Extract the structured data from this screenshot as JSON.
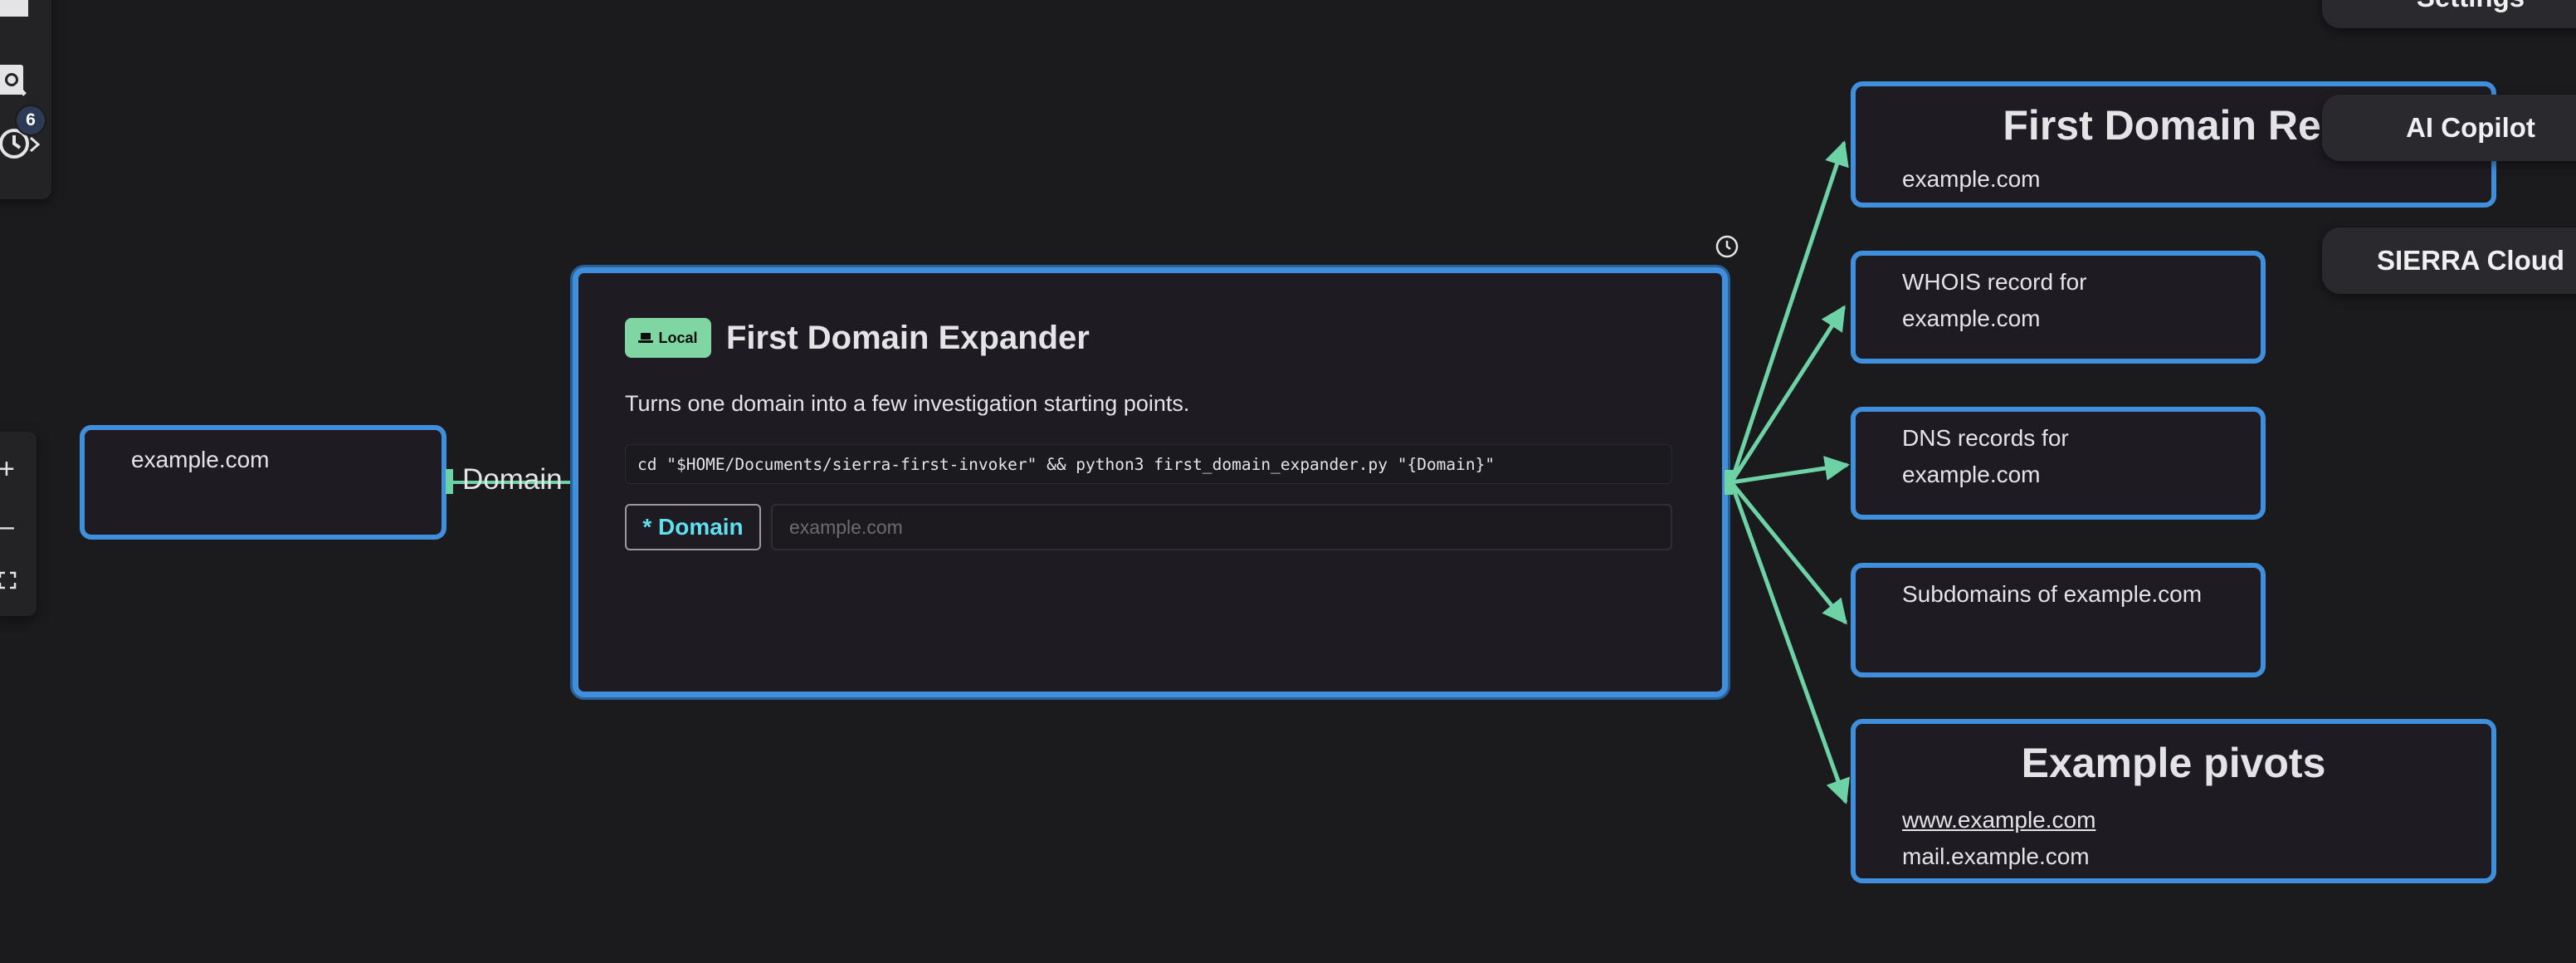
{
  "toolbar": {
    "history_count": "6",
    "zoom_in": "+",
    "zoom_out": "–",
    "icons": [
      "folder-icon",
      "search-icon",
      "history-icon",
      "chevron-right-icon",
      "fit-view-icon"
    ]
  },
  "input_node": {
    "value": "example.com"
  },
  "edge": {
    "label": "Domain"
  },
  "transform_node": {
    "badge": "Local",
    "title": "First Domain Expander",
    "description": "Turns one domain into a few investigation starting points.",
    "command": "cd \"$HOME/Documents/sierra-first-invoker\" && python3 first_domain_expander.py \"{Domain}\"",
    "param_label": "* Domain",
    "param_placeholder": "example.com"
  },
  "output_nodes": {
    "result": {
      "title": "First Domain Res",
      "text": "example.com"
    },
    "whois": {
      "line1": "WHOIS record for",
      "line2": "example.com"
    },
    "dns": {
      "line1": "DNS records for",
      "line2": "example.com"
    },
    "subdomains": {
      "text": "Subdomains of example.com"
    },
    "pivots": {
      "title": "Example pivots",
      "link1": "www.example.com",
      "text2": "mail.example.com"
    }
  },
  "side_panel": {
    "settings": "Settings",
    "ai_copilot": "AI Copilot",
    "sierra_cloud": "SIERRA Cloud"
  },
  "colors": {
    "node_border": "#3f8fdc",
    "edge": "#6dd3a6",
    "background": "#1b1b1d",
    "local_badge": "#7fd6a3",
    "param_label": "#5ee0f0"
  }
}
